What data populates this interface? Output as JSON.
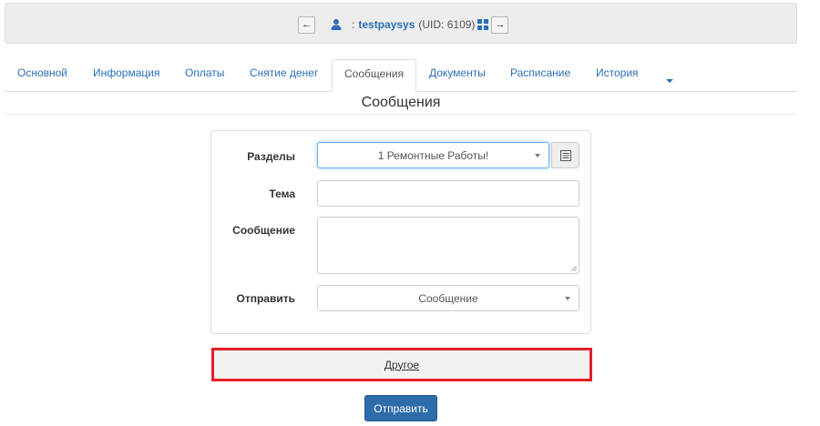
{
  "userbar": {
    "prev_label": "←",
    "next_label": "→",
    "separator": ":",
    "login": "testpaysys",
    "uid_text": "(UID: 6109)"
  },
  "tabs": [
    {
      "label": "Основной"
    },
    {
      "label": "Информация"
    },
    {
      "label": "Оплаты"
    },
    {
      "label": "Снятие денег"
    },
    {
      "label": "Сообщения",
      "active": true
    },
    {
      "label": "Документы"
    },
    {
      "label": "Расписание"
    },
    {
      "label": "История"
    }
  ],
  "page": {
    "title": "Сообщения"
  },
  "form": {
    "section_label": "Разделы",
    "section_value": "1 Ремонтные Работы!",
    "subject_label": "Тема",
    "subject_value": "",
    "message_label": "Сообщение",
    "message_value": "",
    "send_label": "Отправить",
    "send_value": "Сообщение"
  },
  "other_toggle": {
    "label": "Другое"
  },
  "submit": {
    "label": "Отправить"
  },
  "colors": {
    "link": "#2a6fb5",
    "primary_button": "#2d6ca8",
    "highlight_border": "#e4202a"
  }
}
